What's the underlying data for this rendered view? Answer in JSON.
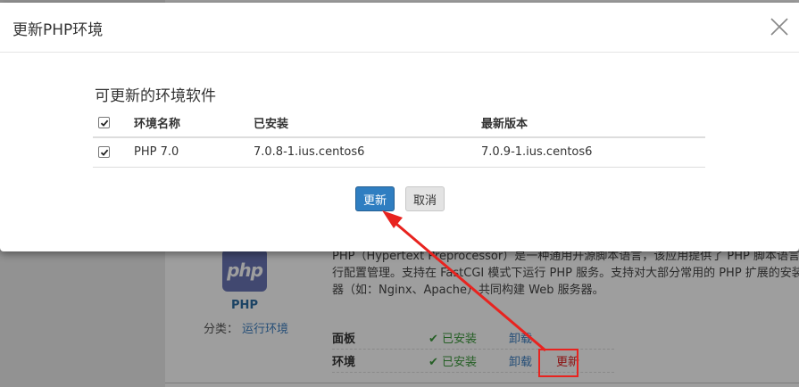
{
  "modal": {
    "title": "更新PHP环境",
    "section_title": "可更新的环境软件",
    "table": {
      "headers": [
        "环境名称",
        "已安装",
        "最新版本"
      ],
      "rows": [
        {
          "checked": true,
          "name": "PHP 7.0",
          "installed": "7.0.8-1.ius.centos6",
          "latest": "7.0.9-1.ius.centos6"
        }
      ]
    },
    "buttons": {
      "update": "更新",
      "cancel": "取消"
    }
  },
  "background": {
    "app_logo_text": "php",
    "app_name": "PHP",
    "category_label": "分类：",
    "category_value": "运行环境",
    "description_lines": [
      "PHP（Hypertext Preprocessor）是一种通用开源脚本语言，该应用提供了 PHP 脚本语言运行",
      "行配置管理。支持在 FastCGI 模式下运行 PHP 服务。支持对大部分常用的 PHP 扩展的安装和",
      "器（如：Nginx、Apache）共同构建 Web 服务器。"
    ],
    "components": [
      {
        "name": "面板",
        "status": "✔ 已安装",
        "uninstall": "卸载",
        "update": ""
      },
      {
        "name": "环境",
        "status": "✔ 已安装",
        "uninstall": "卸载",
        "update": "更新"
      }
    ]
  },
  "colors": {
    "primary_button": "#2f7ec1",
    "annotation_red": "#e8231f",
    "installed_green": "#3c9a3c",
    "link_blue": "#3d7fc1"
  }
}
